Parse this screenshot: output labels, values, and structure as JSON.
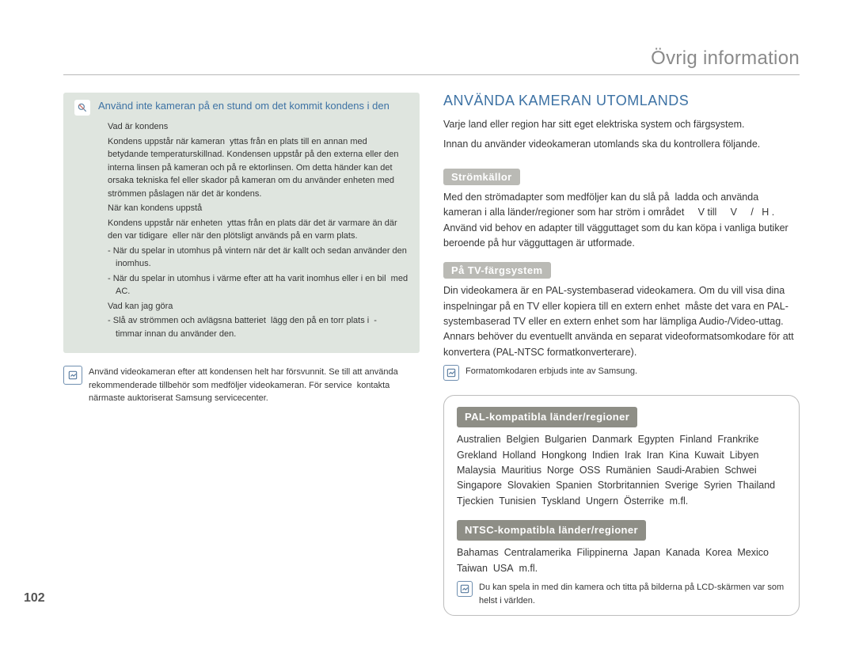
{
  "chapter_title": "Övrig information",
  "page_number": "102",
  "left": {
    "warning": {
      "title": "Använd inte kameran på en stund om det kommit kondens i den",
      "q1": "Vad är kondens",
      "p1": "Kondens uppstår när kameran  yttas från en plats till en annan med betydande temperaturskillnad. Kondensen uppstår på den externa eller den interna linsen på kameran och på re ektorlinsen. Om detta händer kan det orsaka tekniska fel eller skador på kameran om du använder enheten med strömmen påslagen när det är kondens.",
      "q2": "När kan kondens uppstå",
      "p2": "Kondens uppstår när enheten  yttas från en plats där det är varmare än där den var tidigare  eller när den plötsligt används på en varm plats.",
      "b1": "När du spelar in utomhus på vintern när det är kallt och sedan använder den inomhus.",
      "b2": "När du spelar in utomhus i värme efter att ha varit inomhus eller i en bil  med AC.",
      "q3": "Vad kan jag göra",
      "b3": "Slå av strömmen och avlägsna batteriet  lägg den på en torr plats i  -   timmar innan du använder den."
    },
    "note": "Använd videokameran efter att kondensen helt har försvunnit. Se till att använda rekommenderade tillbehör som medföljer videokameran. För service  kontakta närmaste auktoriserat Samsung servicecenter."
  },
  "right": {
    "section_title": "ANVÄNDA KAMERAN UTOMLANDS",
    "intro": [
      "Varje land eller region har sitt eget elektriska system och färgsystem.",
      "Innan du använder videokameran utomlands ska du kontrollera följande."
    ],
    "power": {
      "heading": "Strömkällor",
      "text": "Med den strömadapter som medföljer kan du slå på  ladda och använda kameran i alla länder/regioner som har ström i området     V till     V     /   H . Använd vid behov en adapter till vägguttaget som du kan köpa i vanliga butiker  beroende på hur vägguttagen är utformade."
    },
    "tv": {
      "heading": "På TV-färgsystem",
      "text": "Din videokamera är en PAL-systembaserad videokamera. Om du vill visa dina inspelningar på en TV eller kopiera till en extern enhet  måste det vara en PAL-systembaserad TV eller en extern enhet som har lämpliga Audio-/Video-uttag. Annars behöver du eventuellt använda en separat videoformatsomkodare för att konvertera (PAL-NTSC formatkonverterare).",
      "note": "Formatomkodaren erbjuds inte av Samsung."
    },
    "pal": {
      "heading": "PAL-kompatibla länder/regioner",
      "text": "Australien  Belgien  Bulgarien  Danmark  Egypten  Finland  Frankrike  Grekland  Holland  Hongkong  Indien  Irak  Iran  Kina  Kuwait  Libyen  Malaysia  Mauritius  Norge  OSS  Rumänien  Saudi-Arabien  Schwei   Singapore  Slovakien  Spanien  Storbritannien  Sverige  Syrien  Thailand  Tjeckien  Tunisien  Tyskland  Ungern  Österrike  m.fl."
    },
    "ntsc": {
      "heading": "NTSC-kompatibla länder/regioner",
      "text": "Bahamas  Centralamerika  Filippinerna  Japan  Kanada  Korea  Mexico  Taiwan  USA  m.fl.",
      "note": "Du kan spela in med din kamera och titta på bilderna på LCD-skärmen var som helst i världen."
    }
  }
}
